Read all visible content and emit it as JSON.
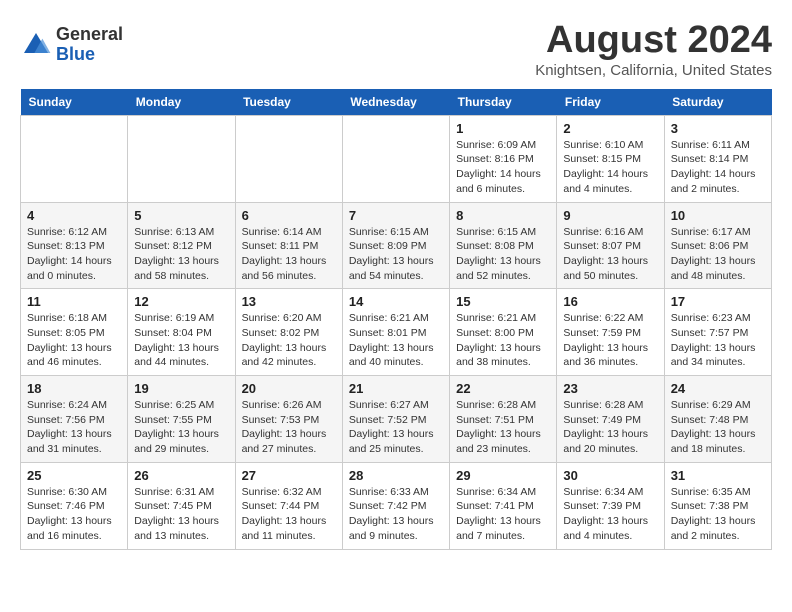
{
  "header": {
    "logo_general": "General",
    "logo_blue": "Blue",
    "month_year": "August 2024",
    "location": "Knightsen, California, United States"
  },
  "calendar": {
    "days_of_week": [
      "Sunday",
      "Monday",
      "Tuesday",
      "Wednesday",
      "Thursday",
      "Friday",
      "Saturday"
    ],
    "weeks": [
      [
        {
          "day": "",
          "info": ""
        },
        {
          "day": "",
          "info": ""
        },
        {
          "day": "",
          "info": ""
        },
        {
          "day": "",
          "info": ""
        },
        {
          "day": "1",
          "info": "Sunrise: 6:09 AM\nSunset: 8:16 PM\nDaylight: 14 hours\nand 6 minutes."
        },
        {
          "day": "2",
          "info": "Sunrise: 6:10 AM\nSunset: 8:15 PM\nDaylight: 14 hours\nand 4 minutes."
        },
        {
          "day": "3",
          "info": "Sunrise: 6:11 AM\nSunset: 8:14 PM\nDaylight: 14 hours\nand 2 minutes."
        }
      ],
      [
        {
          "day": "4",
          "info": "Sunrise: 6:12 AM\nSunset: 8:13 PM\nDaylight: 14 hours\nand 0 minutes."
        },
        {
          "day": "5",
          "info": "Sunrise: 6:13 AM\nSunset: 8:12 PM\nDaylight: 13 hours\nand 58 minutes."
        },
        {
          "day": "6",
          "info": "Sunrise: 6:14 AM\nSunset: 8:11 PM\nDaylight: 13 hours\nand 56 minutes."
        },
        {
          "day": "7",
          "info": "Sunrise: 6:15 AM\nSunset: 8:09 PM\nDaylight: 13 hours\nand 54 minutes."
        },
        {
          "day": "8",
          "info": "Sunrise: 6:15 AM\nSunset: 8:08 PM\nDaylight: 13 hours\nand 52 minutes."
        },
        {
          "day": "9",
          "info": "Sunrise: 6:16 AM\nSunset: 8:07 PM\nDaylight: 13 hours\nand 50 minutes."
        },
        {
          "day": "10",
          "info": "Sunrise: 6:17 AM\nSunset: 8:06 PM\nDaylight: 13 hours\nand 48 minutes."
        }
      ],
      [
        {
          "day": "11",
          "info": "Sunrise: 6:18 AM\nSunset: 8:05 PM\nDaylight: 13 hours\nand 46 minutes."
        },
        {
          "day": "12",
          "info": "Sunrise: 6:19 AM\nSunset: 8:04 PM\nDaylight: 13 hours\nand 44 minutes."
        },
        {
          "day": "13",
          "info": "Sunrise: 6:20 AM\nSunset: 8:02 PM\nDaylight: 13 hours\nand 42 minutes."
        },
        {
          "day": "14",
          "info": "Sunrise: 6:21 AM\nSunset: 8:01 PM\nDaylight: 13 hours\nand 40 minutes."
        },
        {
          "day": "15",
          "info": "Sunrise: 6:21 AM\nSunset: 8:00 PM\nDaylight: 13 hours\nand 38 minutes."
        },
        {
          "day": "16",
          "info": "Sunrise: 6:22 AM\nSunset: 7:59 PM\nDaylight: 13 hours\nand 36 minutes."
        },
        {
          "day": "17",
          "info": "Sunrise: 6:23 AM\nSunset: 7:57 PM\nDaylight: 13 hours\nand 34 minutes."
        }
      ],
      [
        {
          "day": "18",
          "info": "Sunrise: 6:24 AM\nSunset: 7:56 PM\nDaylight: 13 hours\nand 31 minutes."
        },
        {
          "day": "19",
          "info": "Sunrise: 6:25 AM\nSunset: 7:55 PM\nDaylight: 13 hours\nand 29 minutes."
        },
        {
          "day": "20",
          "info": "Sunrise: 6:26 AM\nSunset: 7:53 PM\nDaylight: 13 hours\nand 27 minutes."
        },
        {
          "day": "21",
          "info": "Sunrise: 6:27 AM\nSunset: 7:52 PM\nDaylight: 13 hours\nand 25 minutes."
        },
        {
          "day": "22",
          "info": "Sunrise: 6:28 AM\nSunset: 7:51 PM\nDaylight: 13 hours\nand 23 minutes."
        },
        {
          "day": "23",
          "info": "Sunrise: 6:28 AM\nSunset: 7:49 PM\nDaylight: 13 hours\nand 20 minutes."
        },
        {
          "day": "24",
          "info": "Sunrise: 6:29 AM\nSunset: 7:48 PM\nDaylight: 13 hours\nand 18 minutes."
        }
      ],
      [
        {
          "day": "25",
          "info": "Sunrise: 6:30 AM\nSunset: 7:46 PM\nDaylight: 13 hours\nand 16 minutes."
        },
        {
          "day": "26",
          "info": "Sunrise: 6:31 AM\nSunset: 7:45 PM\nDaylight: 13 hours\nand 13 minutes."
        },
        {
          "day": "27",
          "info": "Sunrise: 6:32 AM\nSunset: 7:44 PM\nDaylight: 13 hours\nand 11 minutes."
        },
        {
          "day": "28",
          "info": "Sunrise: 6:33 AM\nSunset: 7:42 PM\nDaylight: 13 hours\nand 9 minutes."
        },
        {
          "day": "29",
          "info": "Sunrise: 6:34 AM\nSunset: 7:41 PM\nDaylight: 13 hours\nand 7 minutes."
        },
        {
          "day": "30",
          "info": "Sunrise: 6:34 AM\nSunset: 7:39 PM\nDaylight: 13 hours\nand 4 minutes."
        },
        {
          "day": "31",
          "info": "Sunrise: 6:35 AM\nSunset: 7:38 PM\nDaylight: 13 hours\nand 2 minutes."
        }
      ]
    ]
  }
}
